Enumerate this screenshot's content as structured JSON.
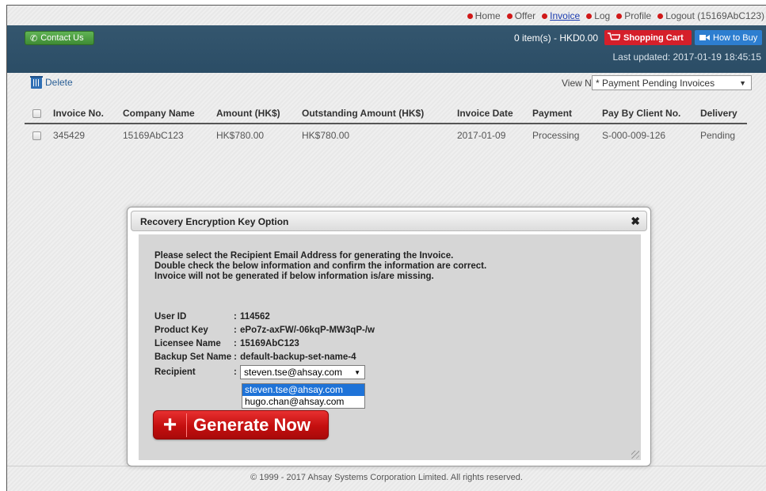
{
  "toplinks": {
    "items": [
      "Home",
      "Offer",
      "Invoice",
      "Log",
      "Profile",
      "Logout (15169AbC123)"
    ]
  },
  "header": {
    "contact_label": "Contact Us",
    "cart_summary": "0 item(s) - HKD0.00",
    "cart_label": "Shopping Cart",
    "howtobuy_label": "How to Buy",
    "last_updated": "Last updated: 2017-01-19 18:45:15"
  },
  "toolbar": {
    "delete_label": "Delete",
    "view_label": "View Name",
    "view_value": "* Payment Pending Invoices"
  },
  "table": {
    "headers": [
      "Invoice No.",
      "Company Name",
      "Amount (HK$)",
      "Outstanding Amount (HK$)",
      "Invoice Date",
      "Payment",
      "Pay By Client No.",
      "Delivery"
    ],
    "rows": [
      [
        "345429",
        "15169AbC123",
        "HK$780.00",
        "HK$780.00",
        "2017-01-09",
        "Processing",
        "S-000-009-126",
        "Pending"
      ]
    ]
  },
  "dialog": {
    "title": "Recovery Encryption Key Option",
    "instructions": [
      "Please select the Recipient Email Address for generating the Invoice.",
      "Double check the below information and confirm the information are correct.",
      "Invoice will not be generated if below information is/are missing."
    ],
    "user_id_label": "User ID",
    "user_id": "114562",
    "product_key_label": "Product Key",
    "product_key": "ePo7z-axFW/-06kqP-MW3qP-/w",
    "licensee_label": "Licensee Name",
    "licensee": "15169AbC123",
    "backup_label": "Backup Set Name",
    "backup": "default-backup-set-name-4",
    "recipient_label": "Recipient",
    "recipient_value": "steven.tse@ahsay.com",
    "recipient_options": [
      "steven.tse@ahsay.com",
      "hugo.chan@ahsay.com"
    ],
    "generate_label": "Generate Now",
    "generate_symbol": "+"
  },
  "footer": {
    "text": "© 1999 - 2017 Ahsay Systems Corporation Limited. All rights reserved."
  },
  "colors": {
    "header_bg": "#2b4d66",
    "link_dot": "#d01818",
    "cart_red": "#d51f2a",
    "howtobuy_blue": "#2d7ed0",
    "generate_red": "#c40f0f",
    "selection_blue": "#1e73d8"
  }
}
